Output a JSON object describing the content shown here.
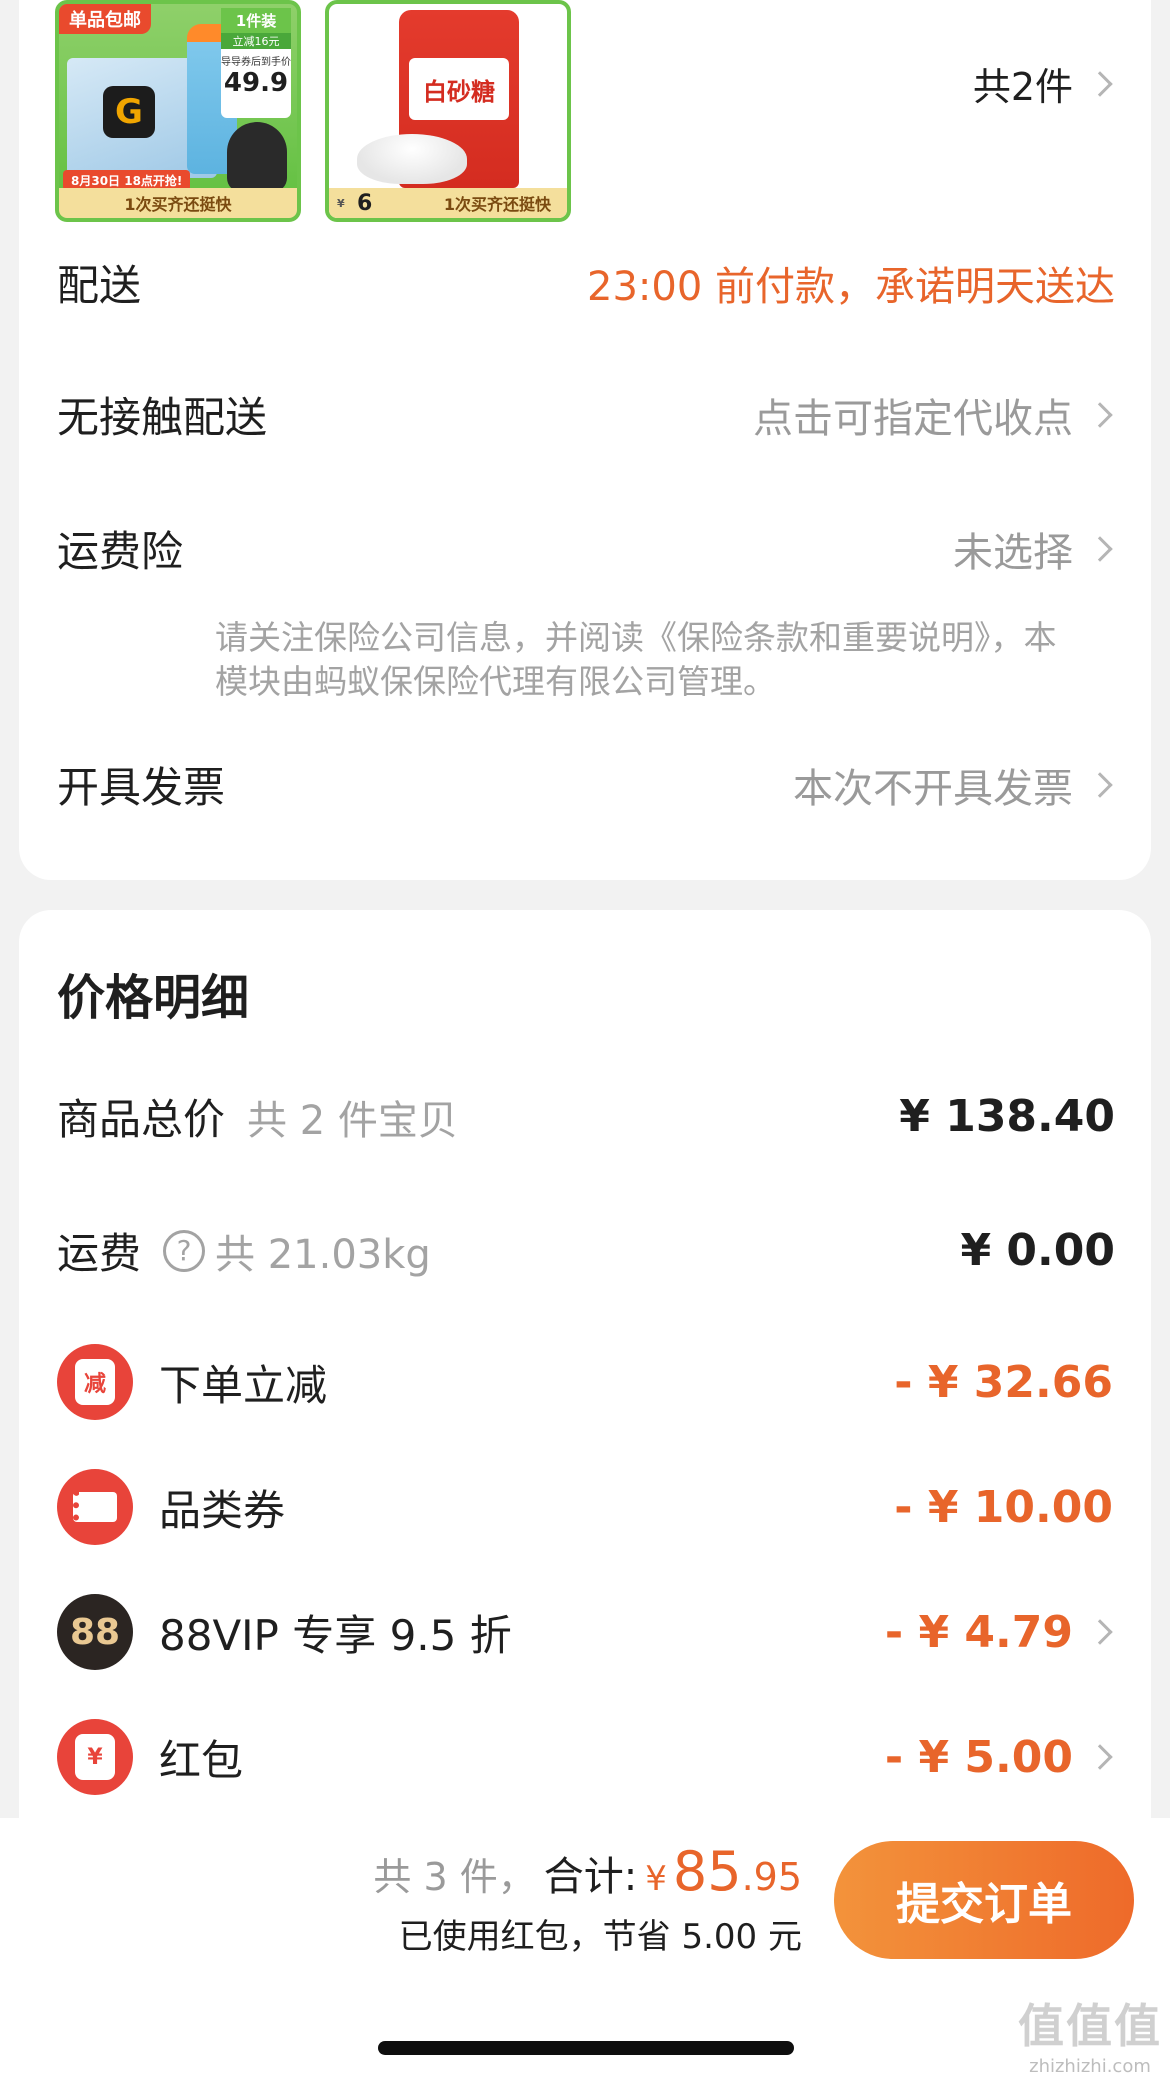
{
  "order": {
    "products": [
      {
        "top_tag": "单品包邮",
        "brand": "G",
        "promo_head": "1件装",
        "promo_sub": "立减16元",
        "price_label": "导导券后到手价",
        "price": "49.9",
        "date_tag": "8月30日 18点开抢!",
        "strip": "1次买齐还挺快"
      },
      {
        "bag_text": "白砂糖",
        "price_prefix": "¥",
        "price": "6",
        "strip": "1次买齐还挺快"
      }
    ],
    "count_link": "共2件",
    "delivery": {
      "label": "配送",
      "value": "23:00 前付款，承诺明天送达"
    },
    "contactless": {
      "label": "无接触配送",
      "value": "点击可指定代收点"
    },
    "insurance": {
      "label": "运费险",
      "value": "未选择",
      "note": "请关注保险公司信息，并阅读《保险条款和重要说明》，本模块由蚂蚁保保险代理有限公司管理。"
    },
    "invoice": {
      "label": "开具发票",
      "value": "本次不开具发票"
    }
  },
  "price_detail": {
    "title": "价格明细",
    "goods_total": {
      "label": "商品总价",
      "sub": "共 2 件宝贝",
      "amount": "¥ 138.40"
    },
    "shipping": {
      "label": "运费",
      "help": "?",
      "sub": "共 21.03kg",
      "amount": "¥ 0.00"
    },
    "discounts": [
      {
        "icon": "order-discount-icon",
        "icon_text": "减",
        "label": "下单立减",
        "amount": "- ¥ 32.66"
      },
      {
        "icon": "coupon-ticket-icon",
        "label": "品类券",
        "amount": "- ¥ 10.00"
      },
      {
        "icon": "vip88-icon",
        "icon_text": "88",
        "label": "88VIP 专享 9.5 折",
        "amount": "- ¥ 4.79"
      },
      {
        "icon": "red-packet-icon",
        "icon_text": "¥",
        "label": "红包",
        "amount": "- ¥ 5.00"
      }
    ]
  },
  "bottom": {
    "count": "共 3 件，",
    "total_label": "合计:",
    "yen": "¥",
    "total_int": "85",
    "total_dec": ".95",
    "savings": "已使用红包，节省 5.00 元",
    "submit": "提交订单"
  },
  "watermark": {
    "logo": "值值值",
    "url": "zhizhizhi.com"
  },
  "colors": {
    "accent_orange": "#e8652b",
    "button_start": "#f3933b",
    "button_end": "#ee6a2a",
    "icon_red": "#e8443a",
    "vip_dark": "#2b2522"
  }
}
